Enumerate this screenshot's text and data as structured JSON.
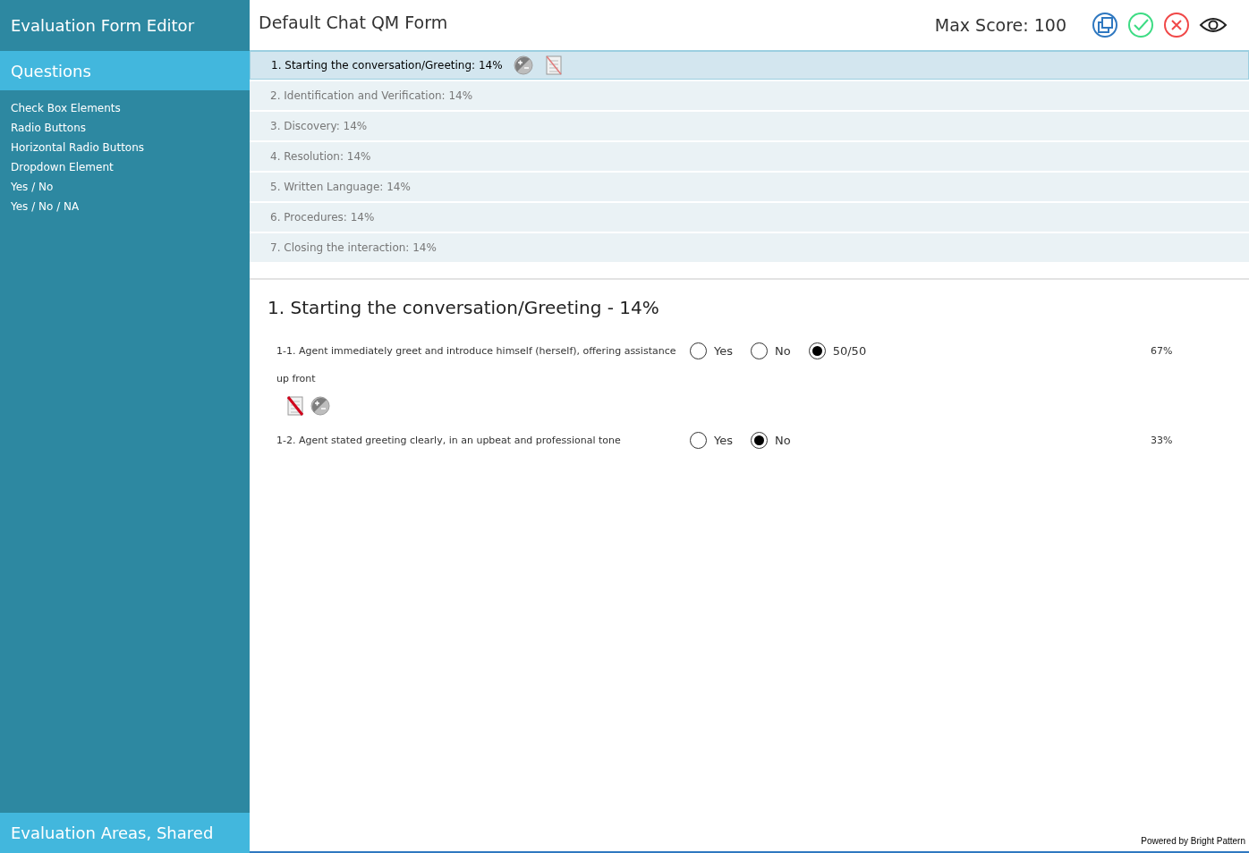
{
  "sidebar": {
    "title": "Evaluation Form Editor",
    "panel_title": "Questions",
    "items": [
      "Check Box Elements",
      "Radio Buttons",
      "Horizontal Radio Buttons",
      "Dropdown Element",
      "Yes / No",
      "Yes / No / NA"
    ],
    "footer": "Evaluation Areas, Shared"
  },
  "header": {
    "form_name": "Default Chat QM Form",
    "max_score": "Max Score: 100"
  },
  "sections": [
    {
      "label": "1. Starting the conversation/Greeting: 14%",
      "selected": true
    },
    {
      "label": "2. Identification and Verification: 14%",
      "selected": false
    },
    {
      "label": "3. Discovery: 14%",
      "selected": false
    },
    {
      "label": "4. Resolution: 14%",
      "selected": false
    },
    {
      "label": "5. Written Language: 14%",
      "selected": false
    },
    {
      "label": "6. Procedures: 14%",
      "selected": false
    },
    {
      "label": "7. Closing the interaction: 14%",
      "selected": false
    }
  ],
  "detail": {
    "heading": "1. Starting the conversation/Greeting - 14%",
    "questions": [
      {
        "text": "1-1. Agent immediately greet and introduce himself (herself), offering assistance up front",
        "percent": "67%",
        "tools_shown": true,
        "answers": [
          {
            "label": "Yes",
            "selected": false
          },
          {
            "label": "No",
            "selected": false
          },
          {
            "label": "50/50",
            "selected": true
          }
        ]
      },
      {
        "text": "1-2. Agent stated greeting clearly, in an upbeat and professional tone",
        "percent": "33%",
        "tools_shown": false,
        "answers": [
          {
            "label": "Yes",
            "selected": false
          },
          {
            "label": "No",
            "selected": true
          }
        ]
      }
    ]
  },
  "footer": "Powered by Bright Pattern"
}
